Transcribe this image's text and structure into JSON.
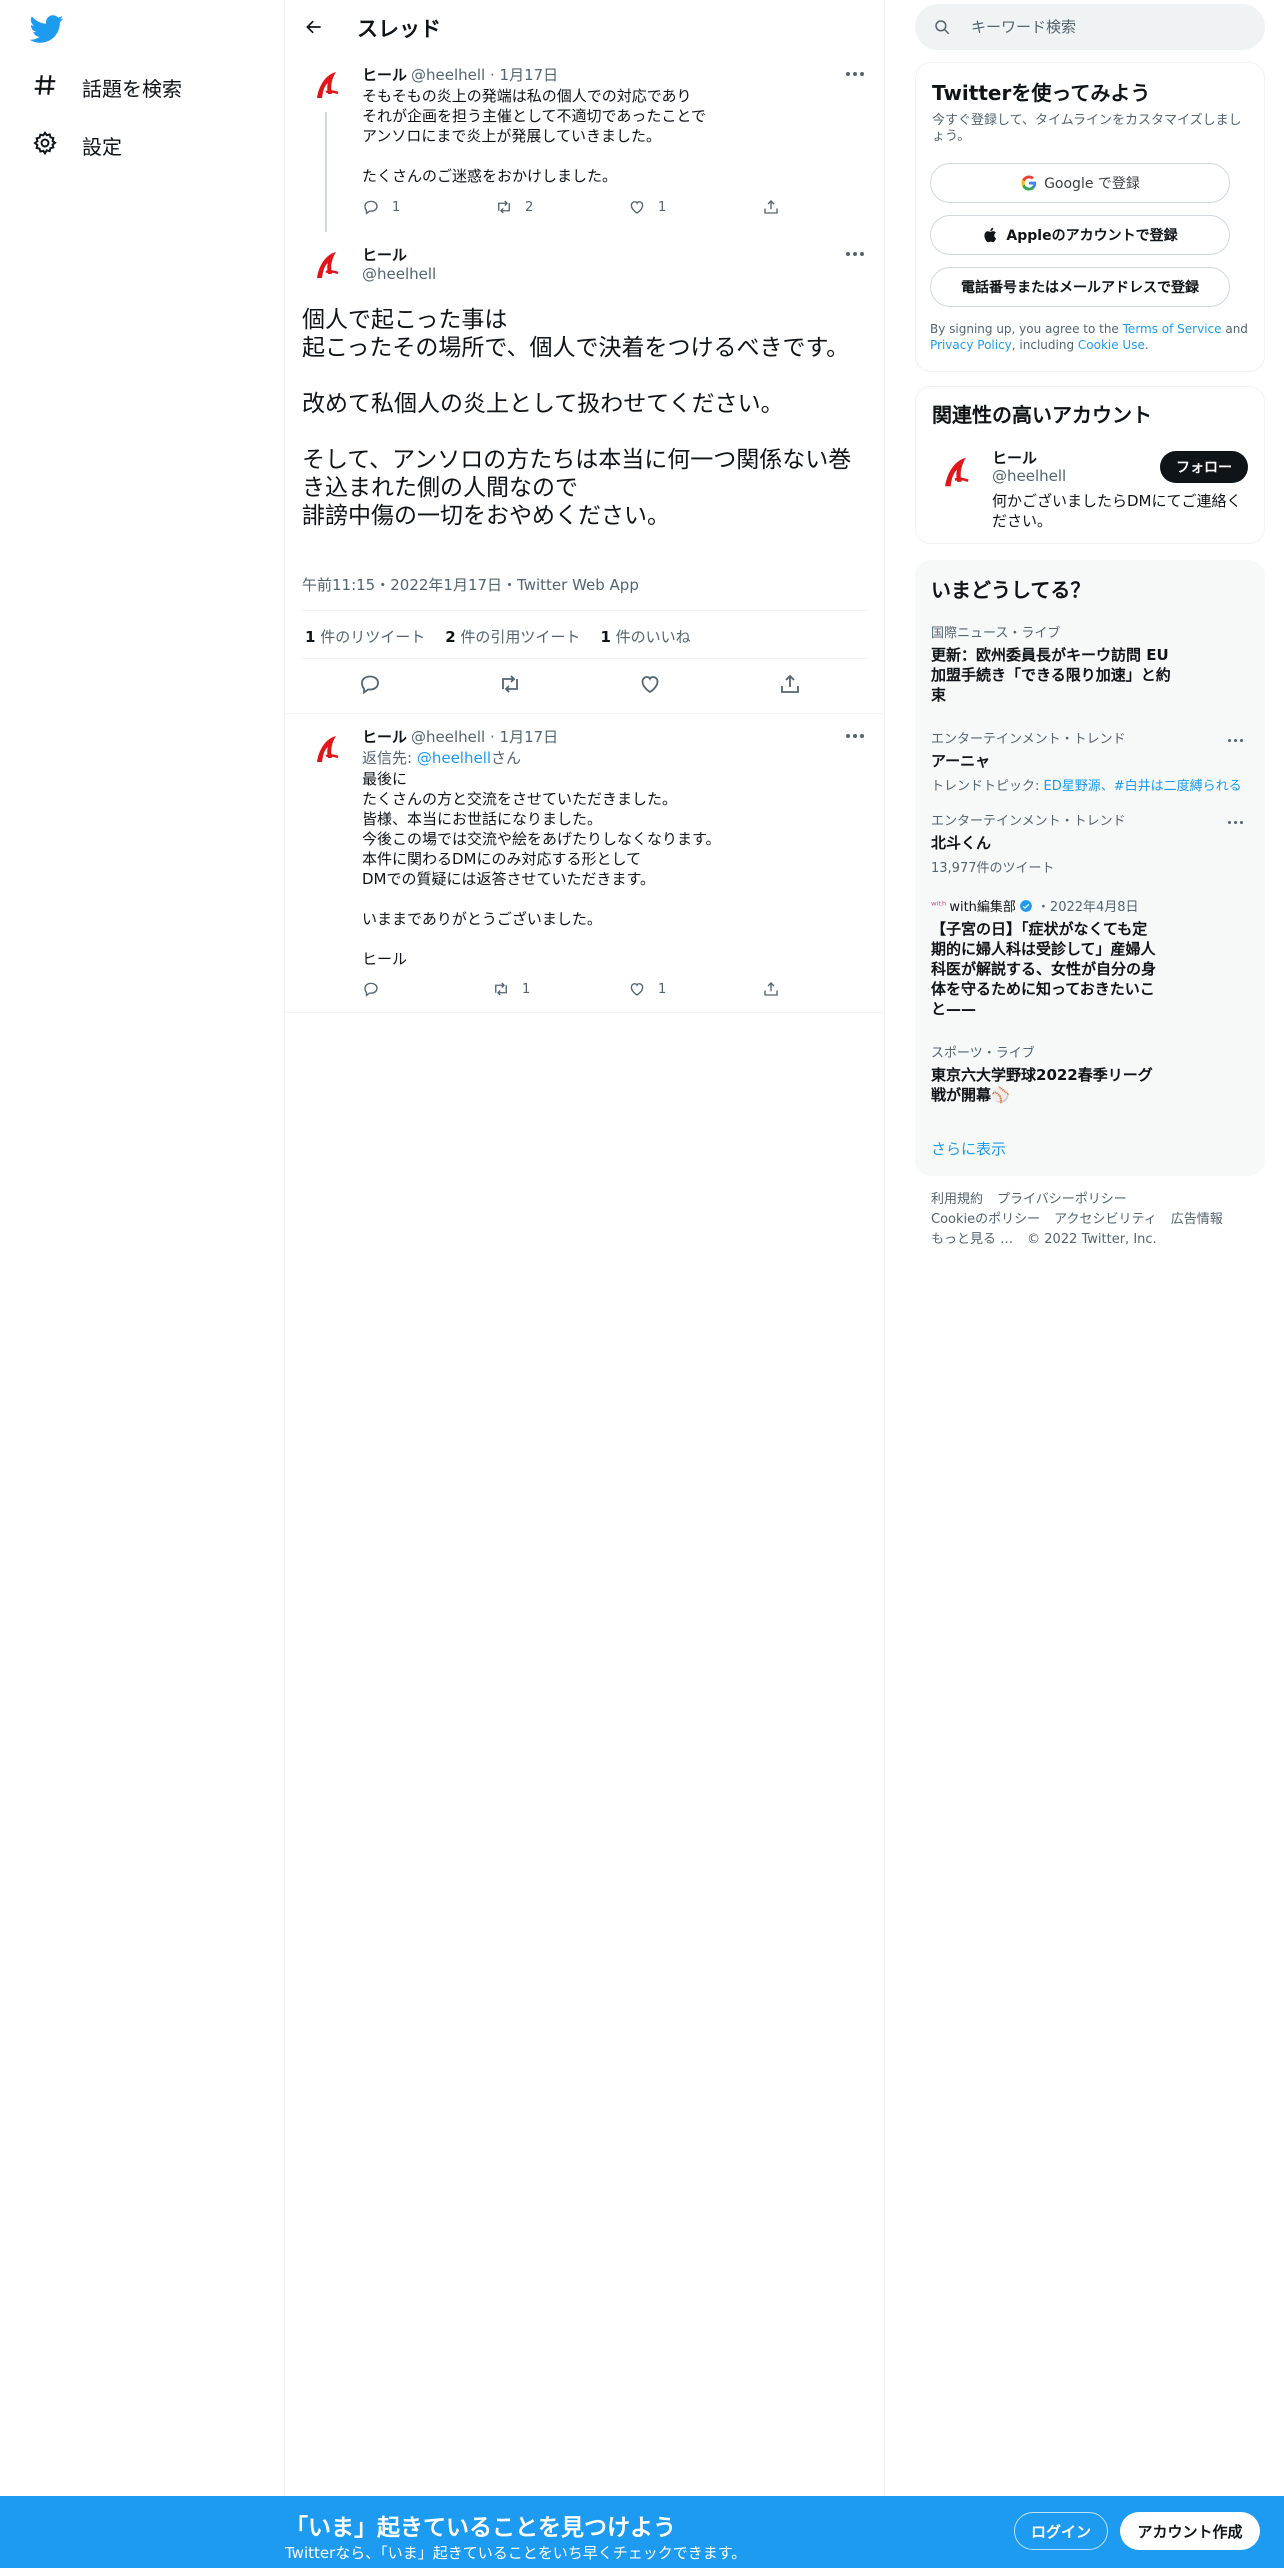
{
  "nav": {
    "items": [
      {
        "label": "話題を検索",
        "icon": "hashtag-icon"
      },
      {
        "label": "設定",
        "icon": "gear-icon"
      }
    ]
  },
  "header": {
    "title": "スレッド"
  },
  "tweets": [
    {
      "name": "ヒール",
      "handle": "@heelhell",
      "date": "1月17日",
      "text": "そもそもの炎上の発端は私の個人での対応であり\nそれが企画を担う主催として不適切であったことで\nアンソロにまで炎上が発展していきました。\n\nたくさんのご迷惑をおかけしました。",
      "replies": "1",
      "retweets": "2",
      "likes": "1"
    },
    {
      "name": "ヒール",
      "handle": "@heelhell",
      "reply_prefix": "返信先: ",
      "reply_handle": "@heelhell",
      "reply_suffix": "さん",
      "date": "1月17日",
      "text": "最後に\nたくさんの方と交流をさせていただきました。\n皆様、本当にお世話になりました。\n今後この場では交流や絵をあげたりしなくなります。\n本件に関わるDMにのみ対応する形として\nDMでの質疑には返答させていただきます。\n\nいままでありがとうございました。\n\nヒール",
      "replies": "",
      "retweets": "1",
      "likes": "1"
    }
  ],
  "main_tweet": {
    "name": "ヒール",
    "handle": "@heelhell",
    "text": "個人で起こった事は\n起こったその場所で、個人で決着をつけるべきです。\n\n改めて私個人の炎上として扱わせてください。\n\nそして、アンソロの方たちは本当に何一つ関係ない巻き込まれた側の人間なので\n誹謗中傷の一切をおやめください。",
    "meta": "午前11:15・2022年1月17日・Twitter Web App",
    "retweet_count": "1",
    "retweet_label": " 件のリツイート",
    "quote_count": "2",
    "quote_label": " 件の引用ツイート",
    "like_count": "1",
    "like_label": " 件のいいね"
  },
  "search": {
    "placeholder": "キーワード検索"
  },
  "signup": {
    "title": "Twitterを使ってみよう",
    "subtitle": "今すぐ登録して、タイムラインをカスタマイズしましょう。",
    "google": "Google で登録",
    "apple": "Appleのアカウントで登録",
    "phone": "電話番号またはメールアドレスで登録",
    "legal_1": "By signing up, you agree to the ",
    "legal_tos": "Terms of Service",
    "legal_2": " and ",
    "legal_pp": "Privacy Policy",
    "legal_3": ", including ",
    "legal_cookie": "Cookie Use",
    "legal_4": "."
  },
  "related": {
    "title": "関連性の高いアカウント",
    "name": "ヒール",
    "handle": "@heelhell",
    "bio": "何かございましたらDMにてご連絡ください。",
    "follow": "フォロー"
  },
  "trends": {
    "title": "いまどうしてる？",
    "items": [
      {
        "category": "国際ニュース・ライブ",
        "title": "更新：欧州委員長がキーウ訪問 EU加盟手続き「できる限り加速」と約束"
      },
      {
        "category": "エンターテインメント・トレンド",
        "title": "アーニャ",
        "sub_prefix": "トレンドトピック: ",
        "sub_links": "ED星野源、#白井は二度縛られる"
      },
      {
        "category": "エンターテインメント・トレンド",
        "title": "北斗くん",
        "sub": "13,977件のツイート"
      },
      {
        "source": "with編集部",
        "date": "・2022年4月8日",
        "title": "【子宮の日】「症状がなくても定期的に婦人科は受診して」産婦人科医が解説する、女性が自分の身体を守るために知っておきたいこと——"
      },
      {
        "category": "スポーツ・ライブ",
        "title": "東京六大学野球2022春季リーグ戦が開幕⚾️"
      }
    ],
    "show_more": "さらに表示"
  },
  "footer": {
    "links": [
      "利用規約",
      "プライバシーポリシー",
      "Cookieのポリシー",
      "アクセシビリティ",
      "広告情報",
      "もっと見る …",
      "© 2022 Twitter, Inc."
    ]
  },
  "bottom_bar": {
    "title": "「いま」起きていることを見つけよう",
    "subtitle": "Twitterなら、「いま」起きていることをいち早くチェックできます。",
    "login": "ログイン",
    "signup": "アカウント作成"
  },
  "colors": {
    "accent": "#1d9bf0",
    "text": "#0f1419",
    "muted": "#536471",
    "avatar_red": "#e0161b"
  }
}
